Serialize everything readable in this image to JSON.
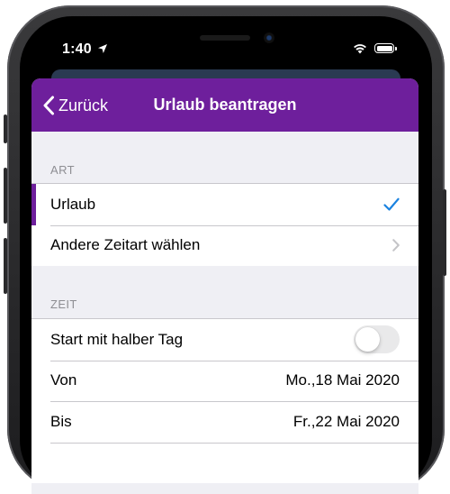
{
  "status_bar": {
    "time": "1:40"
  },
  "nav": {
    "back_label": "Zurück",
    "title": "Urlaub beantragen"
  },
  "sections": {
    "art": {
      "header": "ART",
      "rows": [
        {
          "label": "Urlaub",
          "selected": true,
          "accessory": "checkmark-icon"
        },
        {
          "label": "Andere Zeitart wählen",
          "accessory": "chevron-right-icon"
        }
      ]
    },
    "zeit": {
      "header": "ZEIT",
      "rows": [
        {
          "label": "Start mit halber Tag",
          "toggle_on": false
        },
        {
          "label": "Von",
          "value": "Mo.,18 Mai 2020"
        },
        {
          "label": "Bis",
          "value": "Fr.,22 Mai 2020"
        }
      ]
    }
  },
  "colors": {
    "nav_background": "#6e1f9c",
    "checkmark": "#1a82e0",
    "chevron": "#c4c4c7",
    "background": "#efeff4",
    "section_header": "#8e8e93"
  }
}
